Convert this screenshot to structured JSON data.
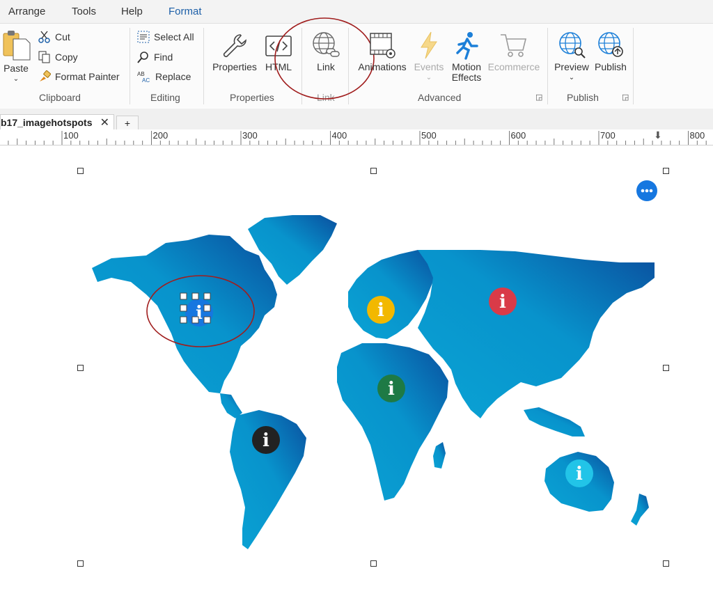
{
  "menu": {
    "items": [
      "Arrange",
      "Tools",
      "Help",
      "Format"
    ]
  },
  "ribbon": {
    "clipboard": {
      "paste": "Paste",
      "cut": "Cut",
      "copy": "Copy",
      "format_painter": "Format Painter",
      "group_label": "Clipboard"
    },
    "editing": {
      "select_all": "Select All",
      "find": "Find",
      "replace": "Replace",
      "group_label": "Editing"
    },
    "properties": {
      "properties": "Properties",
      "html": "HTML",
      "group_label": "Properties"
    },
    "link": {
      "link": "Link",
      "group_label": "Link"
    },
    "advanced": {
      "animations": "Animations",
      "events": "Events",
      "motion_effects_1": "Motion",
      "motion_effects_2": "Effects",
      "ecommerce": "Ecommerce",
      "group_label": "Advanced"
    },
    "publish": {
      "preview": "Preview",
      "publish": "Publish",
      "group_label": "Publish"
    },
    "icons": {
      "replace_top": "AB",
      "replace_bottom": "AC"
    }
  },
  "tabs": {
    "doc_tab": "b17_imagehotspots",
    "close": "✕",
    "add": "+"
  },
  "ruler": {
    "labels": [
      "100",
      "200",
      "300",
      "400",
      "500",
      "600",
      "700",
      "800"
    ]
  },
  "hotspots": {
    "glyph": "i",
    "colors": {
      "north_america": "#1677e0",
      "south_america": "#222222",
      "europe": "#f2b800",
      "africa": "#1e7a45",
      "asia": "#d93b48",
      "australia": "#22c4e8"
    }
  },
  "colors": {
    "map_light": "#0aa0d2",
    "map_dark": "#0a4f9e",
    "annotation": "#a01d1d",
    "accent": "#1c5fa8"
  }
}
